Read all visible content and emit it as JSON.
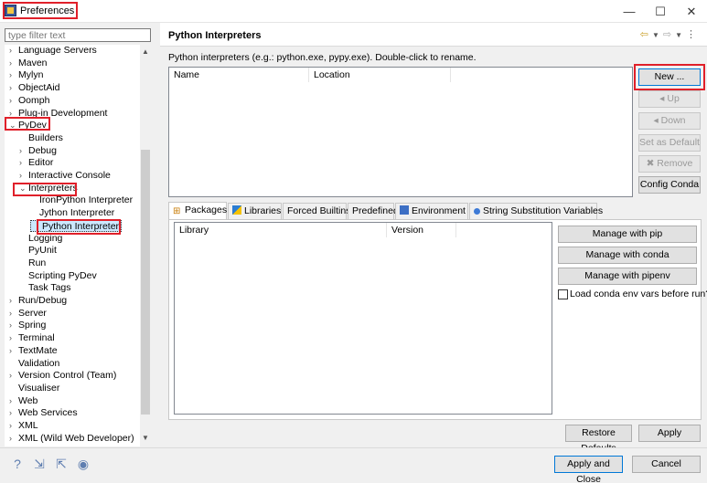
{
  "window": {
    "title": "Preferences",
    "minimize": "—",
    "maximize": "☐",
    "close": "✕"
  },
  "filter": {
    "placeholder": "type filter text"
  },
  "tree": [
    {
      "label": "Language Servers",
      "arrow": ">",
      "depth": 0
    },
    {
      "label": "Maven",
      "arrow": ">",
      "depth": 0
    },
    {
      "label": "Mylyn",
      "arrow": ">",
      "depth": 0
    },
    {
      "label": "ObjectAid",
      "arrow": ">",
      "depth": 0
    },
    {
      "label": "Oomph",
      "arrow": ">",
      "depth": 0
    },
    {
      "label": "Plug-in Development",
      "arrow": ">",
      "depth": 0
    },
    {
      "label": "PyDev",
      "arrow": "v",
      "depth": 0
    },
    {
      "label": "Builders",
      "arrow": "",
      "depth": 1
    },
    {
      "label": "Debug",
      "arrow": ">",
      "depth": 1
    },
    {
      "label": "Editor",
      "arrow": ">",
      "depth": 1
    },
    {
      "label": "Interactive Console",
      "arrow": ">",
      "depth": 1
    },
    {
      "label": "Interpreters",
      "arrow": "v",
      "depth": 1
    },
    {
      "label": "IronPython Interpreter",
      "arrow": "",
      "depth": 2
    },
    {
      "label": "Jython Interpreter",
      "arrow": "",
      "depth": 2
    },
    {
      "label": "Python Interpreter",
      "arrow": "",
      "depth": 2,
      "selected": true
    },
    {
      "label": "Logging",
      "arrow": "",
      "depth": 1
    },
    {
      "label": "PyUnit",
      "arrow": "",
      "depth": 1
    },
    {
      "label": "Run",
      "arrow": "",
      "depth": 1
    },
    {
      "label": "Scripting PyDev",
      "arrow": "",
      "depth": 1
    },
    {
      "label": "Task Tags",
      "arrow": "",
      "depth": 1
    },
    {
      "label": "Run/Debug",
      "arrow": ">",
      "depth": 0
    },
    {
      "label": "Server",
      "arrow": ">",
      "depth": 0
    },
    {
      "label": "Spring",
      "arrow": ">",
      "depth": 0
    },
    {
      "label": "Terminal",
      "arrow": ">",
      "depth": 0
    },
    {
      "label": "TextMate",
      "arrow": ">",
      "depth": 0
    },
    {
      "label": "Validation",
      "arrow": "",
      "depth": 0
    },
    {
      "label": "Version Control (Team)",
      "arrow": ">",
      "depth": 0
    },
    {
      "label": "Visualiser",
      "arrow": "",
      "depth": 0
    },
    {
      "label": "Web",
      "arrow": ">",
      "depth": 0
    },
    {
      "label": "Web Services",
      "arrow": ">",
      "depth": 0
    },
    {
      "label": "XML",
      "arrow": ">",
      "depth": 0
    },
    {
      "label": "XML (Wild Web Developer)",
      "arrow": ">",
      "depth": 0
    }
  ],
  "page": {
    "title": "Python Interpreters",
    "description": "Python interpreters (e.g.: python.exe, pypy.exe).   Double-click to rename."
  },
  "interp_table": {
    "col_name": "Name",
    "col_location": "Location"
  },
  "side_buttons": {
    "new": "New ...",
    "up": "Up",
    "down": "Down",
    "set_default": "Set as Default",
    "remove": "Remove",
    "config_conda": "Config Conda"
  },
  "tabs": [
    "Packages",
    "Libraries",
    "Forced Builtins",
    "Predefined",
    "Environment",
    "String Substitution Variables"
  ],
  "pkg_table": {
    "col_library": "Library",
    "col_version": "Version"
  },
  "pkg_buttons": {
    "pip": "Manage with pip",
    "conda": "Manage with conda",
    "pipenv": "Manage with pipenv",
    "load_conda": "Load conda env vars before run?"
  },
  "footer": {
    "restore_defaults": "Restore Defaults",
    "apply": "Apply",
    "apply_close": "Apply and Close",
    "cancel": "Cancel"
  }
}
